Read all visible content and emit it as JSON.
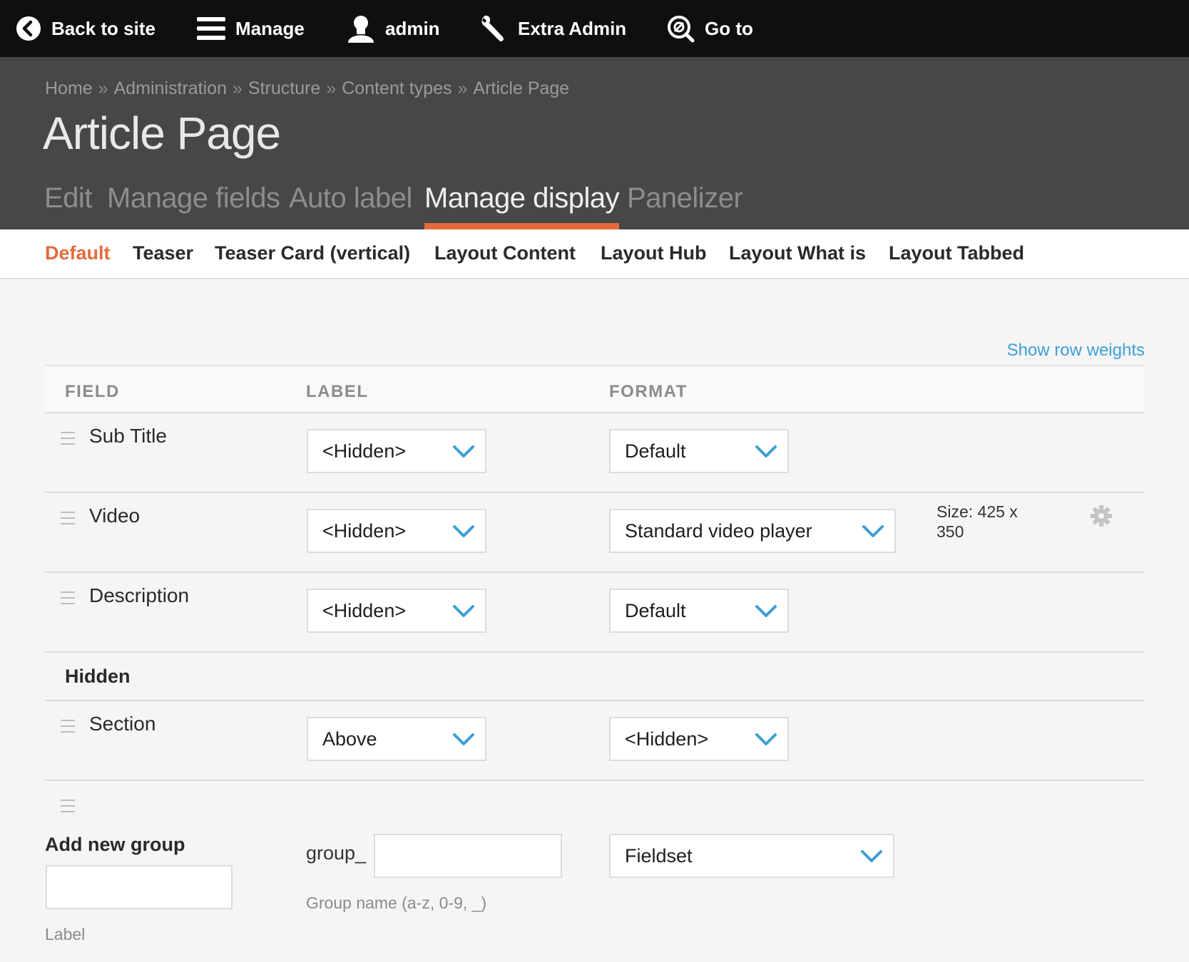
{
  "toolbar": {
    "back_label": "Back to site",
    "manage_label": "Manage",
    "user_label": "admin",
    "extra_admin_label": "Extra Admin",
    "goto_label": "Go to"
  },
  "breadcrumb": {
    "items": [
      "Home",
      "Administration",
      "Structure",
      "Content types",
      "Article Page"
    ],
    "separator": "»"
  },
  "page_title": "Article Page",
  "tabs": [
    {
      "label": "Edit",
      "active": false
    },
    {
      "label": "Manage fields",
      "active": false
    },
    {
      "label": "Auto label",
      "active": false
    },
    {
      "label": "Manage display",
      "active": true
    },
    {
      "label": "Panelizer",
      "active": false
    }
  ],
  "subtabs": [
    {
      "label": "Default",
      "active": true
    },
    {
      "label": "Teaser",
      "active": false
    },
    {
      "label": "Teaser Card (vertical)",
      "active": false
    },
    {
      "label": "Layout Content",
      "active": false
    },
    {
      "label": "Layout Hub",
      "active": false
    },
    {
      "label": "Layout What is",
      "active": false
    },
    {
      "label": "Layout Tabbed",
      "active": false
    }
  ],
  "show_row_weights": "Show row weights",
  "table": {
    "headers": {
      "field": "FIELD",
      "label": "LABEL",
      "format": "FORMAT"
    },
    "rows": [
      {
        "name": "Sub Title",
        "label": "<Hidden>",
        "format": "Default"
      },
      {
        "name": "Video",
        "label": "<Hidden>",
        "format": "Standard video player",
        "summary": "Size: 425 x 350"
      },
      {
        "name": "Description",
        "label": "<Hidden>",
        "format": "Default"
      }
    ],
    "hidden_region": {
      "title": "Hidden",
      "rows": [
        {
          "name": "Section",
          "label": "Above",
          "format": "<Hidden>"
        }
      ]
    },
    "add_group": {
      "title": "Add new group",
      "label_input_value": "",
      "label_description": "Label",
      "name_prefix": "group_",
      "name_input_value": "",
      "name_description": "Group name (a-z, 0-9, _)",
      "format": "Fieldset"
    }
  },
  "colors": {
    "toolbar_bg": "#0f0f0f",
    "header_bg": "#474747",
    "accent": "#e36a3c",
    "link": "#3d9fd7",
    "chevron": "#3d9fd7"
  }
}
